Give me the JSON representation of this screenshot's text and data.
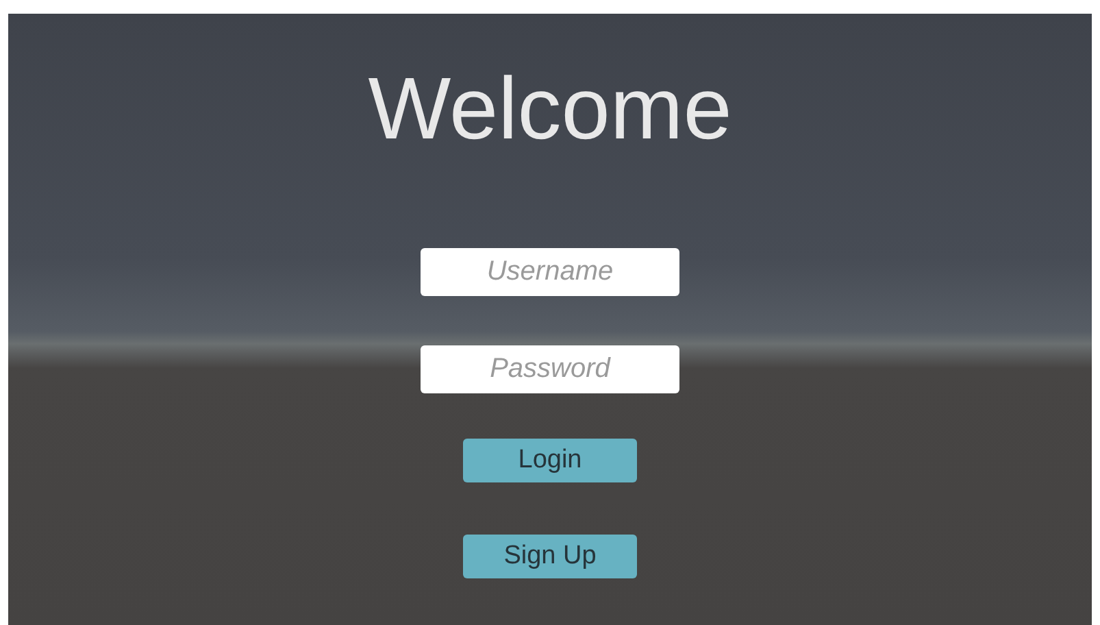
{
  "title": "Welcome",
  "fields": [
    {
      "placeholder": "Username"
    },
    {
      "placeholder": "Password"
    }
  ],
  "buttons": [
    "Login",
    "Sign Up"
  ]
}
